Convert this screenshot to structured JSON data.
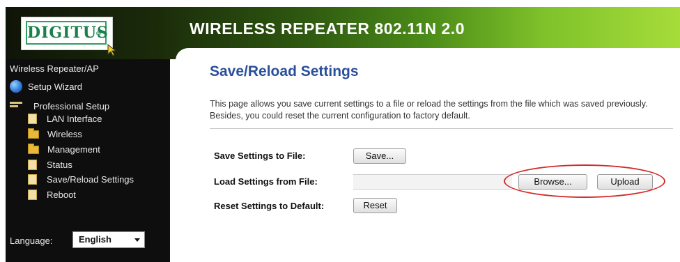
{
  "header": {
    "logo_text": "DIGITUS",
    "logo_mark": "®",
    "product_title": "WIRELESS REPEATER 802.11N 2.0"
  },
  "sidebar": {
    "title": "Wireless Repeater/AP",
    "items": [
      {
        "label": "Setup Wizard",
        "icon": "globe-icon"
      },
      {
        "label": "Professional Setup",
        "icon": "tree-icon"
      },
      {
        "label": "LAN Interface",
        "icon": "document-icon"
      },
      {
        "label": "Wireless",
        "icon": "folder-icon"
      },
      {
        "label": "Management",
        "icon": "folder-icon"
      },
      {
        "label": "Status",
        "icon": "document-icon"
      },
      {
        "label": "Save/Reload Settings",
        "icon": "document-icon"
      },
      {
        "label": "Reboot",
        "icon": "document-icon"
      }
    ],
    "language_label": "Language:",
    "language_value": "English"
  },
  "main": {
    "title": "Save/Reload Settings",
    "description": "This page allows you save current settings to a file or reload the settings from the file which was saved previously. Besides, you could reset the current configuration to factory default.",
    "rows": {
      "save": {
        "label": "Save Settings to File:",
        "button": "Save..."
      },
      "load": {
        "label": "Load Settings from File:",
        "browse": "Browse...",
        "upload": "Upload"
      },
      "reset": {
        "label": "Reset Settings to Default:",
        "button": "Reset"
      }
    }
  },
  "colors": {
    "title_blue": "#2b4f9c",
    "logo_green": "#1a7f4a",
    "highlight_red": "#d42b2b",
    "sidebar_bg": "#0e0e0e"
  }
}
